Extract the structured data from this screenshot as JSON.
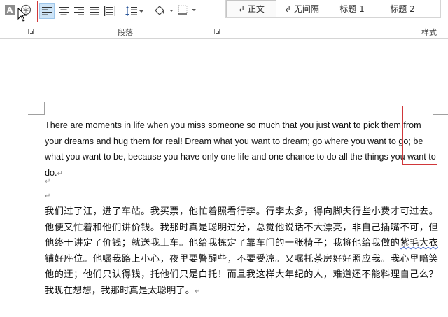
{
  "ribbon": {
    "paragraph_group_label": "段落",
    "styles_group_label": "样式",
    "styles": [
      {
        "label": "↲ 正文",
        "selected": true
      },
      {
        "label": "↲ 无间隔",
        "selected": false
      },
      {
        "label": "标题 1",
        "selected": false
      },
      {
        "label": "标题 2",
        "selected": false
      }
    ],
    "colors": {
      "highlight_outline": "#d0373a",
      "active_button": "#cde4f7"
    }
  },
  "document": {
    "english_paragraph": "There are moments in life when you miss someone so much that you just want to pick them from your dreams and hug them for real! Dream what you want to dream; go where you want to go; be what you want to be, because you have only one life and one chance to do all the things you want to do.",
    "paragraph_mark": "↵",
    "chinese_paragraph_a": "我们过了江，进了车站。我买票，他忙着照看行李。行李太多，得向脚夫行些小费才可过去。他便又忙着和他们讲价钱。我那时真是聪明过分，总觉他说话不大漂亮，非自己插嘴不可，但他终于讲定了价钱；就送我上车。他给我拣定了靠车门的一张椅子；我将他给我做的",
    "chinese_paragraph_underlined": "紫毛大衣",
    "chinese_paragraph_b": "铺好座位。他嘱我路上小心，夜里要警醒些，不要受凉。又嘱托茶房好好照应我。我心里暗笑他的迂；他们只认得钱，托他们只是白托！而且我这样大年纪的人，难道还不能料理自己么？我现在想想，我那时真是太聪明了。"
  }
}
